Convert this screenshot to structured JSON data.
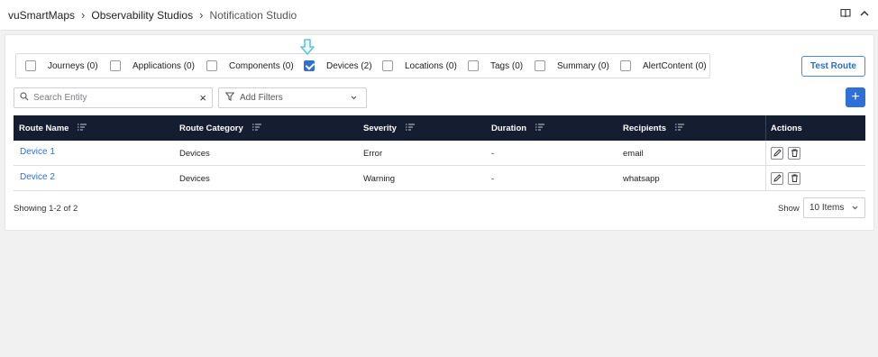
{
  "breadcrumb": [
    "vuSmartMaps",
    "Observability Studios",
    "Notification Studio"
  ],
  "topbar_icons": [
    "book-icon",
    "chevron-up-icon"
  ],
  "entities": [
    {
      "label": "Journeys (0)",
      "checked": false
    },
    {
      "label": "Applications (0)",
      "checked": false
    },
    {
      "label": "Components (0)",
      "checked": false
    },
    {
      "label": "Devices (2)",
      "checked": true
    },
    {
      "label": "Locations (0)",
      "checked": false
    },
    {
      "label": "Tags (0)",
      "checked": false
    },
    {
      "label": "Summary (0)",
      "checked": false
    },
    {
      "label": "AlertContent (0)",
      "checked": false
    }
  ],
  "test_route_label": "Test Route",
  "search": {
    "placeholder": "Search Entity"
  },
  "filters": {
    "label": "Add Filters"
  },
  "add_button": "+",
  "table": {
    "columns": [
      "Route Name",
      "Route Category",
      "Severity",
      "Duration",
      "Recipients",
      "Actions"
    ],
    "rows": [
      {
        "name": "Device 1",
        "category": "Devices",
        "severity": "Error",
        "duration": "-",
        "recipients": "email"
      },
      {
        "name": "Device 2",
        "category": "Devices",
        "severity": "Warning",
        "duration": "-",
        "recipients": "whatsapp"
      }
    ]
  },
  "footer": {
    "showing": "Showing 1-2 of 2",
    "show_label": "Show",
    "page_size": "10 Items"
  },
  "colors": {
    "accent": "#2f6fd6",
    "table_header": "#141e30",
    "hint_arrow": "#5fc7cf"
  }
}
